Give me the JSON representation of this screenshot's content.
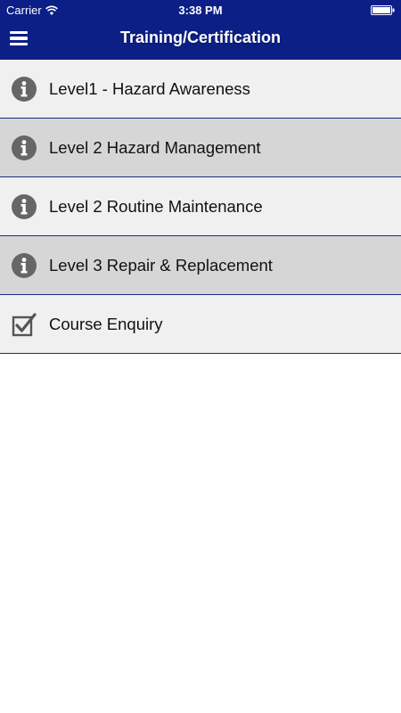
{
  "status_bar": {
    "carrier": "Carrier",
    "time": "3:38 PM"
  },
  "nav": {
    "title": "Training/Certification",
    "menu_icon": "hamburger-menu-icon",
    "bar_color": "#0b1f86"
  },
  "list": {
    "items": [
      {
        "label": "Level1 - Hazard Awareness",
        "icon": "info-icon"
      },
      {
        "label": "Level 2 Hazard Management",
        "icon": "info-icon"
      },
      {
        "label": "Level 2 Routine Maintenance",
        "icon": "info-icon"
      },
      {
        "label": "Level 3 Repair & Replacement",
        "icon": "info-icon"
      },
      {
        "label": "Course Enquiry",
        "icon": "checkbox-checked-icon"
      }
    ],
    "row_colors": [
      "#f0f0f0",
      "#d6d6d6"
    ],
    "divider_color": "#1b2a8c"
  }
}
